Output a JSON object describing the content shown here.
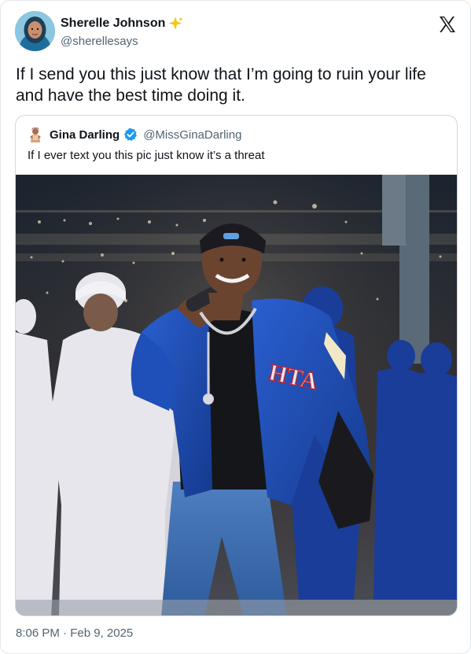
{
  "tweet": {
    "author": {
      "display_name": "Sherelle Johnson",
      "handle": "@sherellesays",
      "badge_icon": "sparkle-icon",
      "badge_color": "#f5c518"
    },
    "text": "If I send you this just know that I’m going to ruin your life and have the best time doing it.",
    "timestamp": "8:06 PM · Feb 9, 2025",
    "platform_logo": "x-logo-icon"
  },
  "quoted_tweet": {
    "author": {
      "display_name": "Gina Darling",
      "handle": "@MissGinaDarling",
      "verified": true,
      "verified_color": "#1d9bf0"
    },
    "text": "If I ever text you this pic just know it’s a threat",
    "photo": {
      "jacket_lettering": "HTA"
    }
  },
  "colors": {
    "text_primary": "#0f1419",
    "text_secondary": "#536471",
    "border": "#cfd9de",
    "jacket_blue": "#1f4fb8"
  }
}
